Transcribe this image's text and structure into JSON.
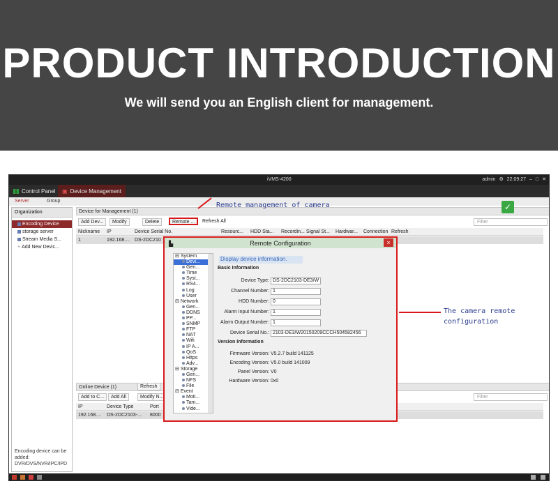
{
  "banner": {
    "title": "PRODUCT INTRODUCTION",
    "subtitle": "We will send you an English client for management."
  },
  "app": {
    "window_title": "iVMS-4200",
    "user": "admin",
    "clock": "22:09:27",
    "menu": {
      "control_panel": "Control Panel",
      "device_management": "Device Management"
    },
    "subtabs": {
      "server": "Server",
      "group": "Group"
    },
    "left_panel": {
      "header": "Organization",
      "items": [
        {
          "label": "Encoding Device",
          "active": true
        },
        {
          "label": "storage server",
          "active": false
        },
        {
          "label": "Stream Media S...",
          "active": false
        },
        {
          "label": "Add New Devic...",
          "active": false
        }
      ],
      "note": "Encoding device can be added: DVR/DVS/NVR/IPC/IPD"
    },
    "device_panel": {
      "header": "Device for Management (1)",
      "buttons": [
        "Add Dev...",
        "Modify",
        "Delete",
        "Remote ...",
        "Refresh All"
      ],
      "filter_placeholder": "Filter",
      "columns": [
        "Nickname",
        "IP",
        "Device Serial No.",
        "Resourc...",
        "HDD Sta...",
        "Recordin...",
        "Signal St...",
        "Hardwar...",
        "Connection",
        "Refresh"
      ],
      "row": {
        "nickname": "1",
        "ip": "192.168....",
        "serial": "DS-2DC210"
      }
    },
    "online_panel": {
      "header": "Online Device (1)",
      "refresh_button": "Refresh",
      "buttons": [
        "Add to C...",
        "Add All",
        "Modify N..."
      ],
      "filter_placeholder": "Filter",
      "columns": [
        "IP",
        "Device Type",
        "Port"
      ],
      "row": {
        "ip": "192.168....",
        "type": "DS-2DC2103-...",
        "port": "8000"
      }
    }
  },
  "dialog": {
    "title": "Remote Configuration",
    "close_label": "×",
    "tree": [
      {
        "label": "System",
        "kind": "cat"
      },
      {
        "label": "Devi...",
        "kind": "child",
        "selected": true
      },
      {
        "label": "Gen...",
        "kind": "child"
      },
      {
        "label": "Time",
        "kind": "child"
      },
      {
        "label": "Syst...",
        "kind": "child"
      },
      {
        "label": "RS4...",
        "kind": "child"
      },
      {
        "label": "Log",
        "kind": "child"
      },
      {
        "label": "User",
        "kind": "child"
      },
      {
        "label": "Network",
        "kind": "cat"
      },
      {
        "label": "Gen...",
        "kind": "child"
      },
      {
        "label": "DDNS",
        "kind": "child"
      },
      {
        "label": "PP...",
        "kind": "child"
      },
      {
        "label": "SNMP",
        "kind": "child"
      },
      {
        "label": "FTP",
        "kind": "child"
      },
      {
        "label": "NAT",
        "kind": "child"
      },
      {
        "label": "Wifi",
        "kind": "child"
      },
      {
        "label": "IP A...",
        "kind": "child"
      },
      {
        "label": "QoS",
        "kind": "child"
      },
      {
        "label": "Https",
        "kind": "child"
      },
      {
        "label": "Adv...",
        "kind": "child"
      },
      {
        "label": "Storage",
        "kind": "cat"
      },
      {
        "label": "Gen...",
        "kind": "child"
      },
      {
        "label": "NFS",
        "kind": "child"
      },
      {
        "label": "File",
        "kind": "child"
      },
      {
        "label": "Event",
        "kind": "cat"
      },
      {
        "label": "Moti...",
        "kind": "child"
      },
      {
        "label": "Tam...",
        "kind": "child"
      },
      {
        "label": "Vide...",
        "kind": "child"
      }
    ],
    "display_info": "Display device information.",
    "basic_info_title": "Basic Information",
    "fields": [
      {
        "label": "Device Type:",
        "value": "DS-2DC2103-DE3/W"
      },
      {
        "label": "Channel Number:",
        "value": "1"
      },
      {
        "label": "HDD Number:",
        "value": "0"
      },
      {
        "label": "Alarm Input Number:",
        "value": "1"
      },
      {
        "label": "Alarm Output Number:",
        "value": "1"
      },
      {
        "label": "Device Serial No.:",
        "value": "2103-DE3/W20150209CCCH504582456"
      }
    ],
    "version_title": "Version Information",
    "versions": [
      {
        "label": "Firmware Version:",
        "value": "V5.2.7 build 141125"
      },
      {
        "label": "Encoding Version:",
        "value": "V5.0 build 141009"
      },
      {
        "label": "Panel Version:",
        "value": "V0"
      },
      {
        "label": "Hardware Version:",
        "value": "0x0"
      }
    ]
  },
  "annotations": {
    "remote_management": "Remote management of camera",
    "remote_configuration_line1": "The camera remote",
    "remote_configuration_line2": "configuration"
  },
  "colors": {
    "banner_bg": "#454545",
    "highlight_red": "#d8191b",
    "annotation_blue": "#2a3c8e",
    "selected_item": "#8d2a2a"
  }
}
